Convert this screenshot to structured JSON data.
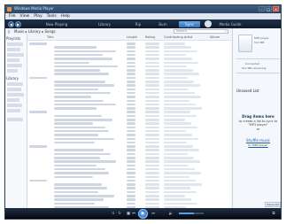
{
  "window": {
    "title": "Windows Media Player"
  },
  "menu": [
    "File",
    "View",
    "Play",
    "Tools",
    "Help"
  ],
  "tabs": [
    {
      "label": "Now Playing",
      "active": false
    },
    {
      "label": "Library",
      "active": false
    },
    {
      "label": "Rip",
      "active": false
    },
    {
      "label": "Burn",
      "active": false
    },
    {
      "label": "Sync",
      "active": true
    },
    {
      "label": "Media Guide",
      "active": false
    }
  ],
  "breadcrumb": "Music ▸ Library ▸ Songs",
  "search": {
    "placeholder": "Search"
  },
  "nav": {
    "playlists": "Playlists",
    "library": "Library"
  },
  "columns": [
    "Title",
    "Length",
    "Rating",
    "Contributing Artist",
    "Album"
  ],
  "list_pane": {
    "header_title": "Unsaved List",
    "drag_title": "Drag items here",
    "drag_sub": "to create a list to sync to \"MP3 player\"",
    "or_text": "or",
    "shuffle_label": "Shuffle music",
    "shuffle_sub": "to 'MP3 player'",
    "save_label": "Save List",
    "device_label": "MP3 player",
    "device_sub": "512 MB",
    "status": "Connected",
    "status_sub": "512 MB remaining"
  },
  "player": {
    "volume_level": 0.6
  },
  "colors": {
    "accent": "#2d6fb7",
    "dark": "#0f1a2c"
  }
}
